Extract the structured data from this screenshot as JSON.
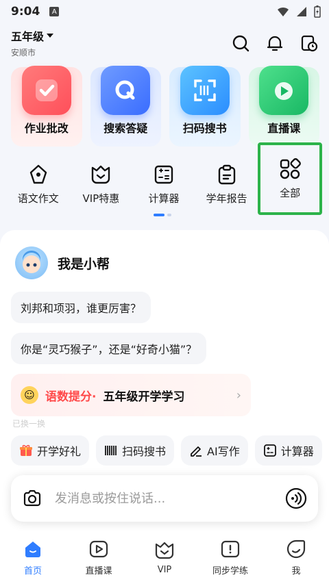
{
  "status_bar": {
    "time": "9:04",
    "notification_letter": "A"
  },
  "header": {
    "grade": "五年级",
    "city": "安顺市"
  },
  "quick_actions": [
    {
      "label": "作业批改",
      "icon": "checkmark-icon"
    },
    {
      "label": "搜索答疑",
      "icon": "search-q-icon"
    },
    {
      "label": "扫码搜书",
      "icon": "scan-icon"
    },
    {
      "label": "直播课",
      "icon": "play-icon"
    }
  ],
  "tools": [
    {
      "label": "语文作文",
      "icon": "pen-nib-icon"
    },
    {
      "label": "VIP特惠",
      "icon": "vip-crown-icon"
    },
    {
      "label": "计算器",
      "icon": "calculator-icon"
    },
    {
      "label": "学年报告",
      "icon": "clipboard-icon"
    },
    {
      "label": "全部",
      "icon": "grid-icon"
    }
  ],
  "chat": {
    "bot_name": "我是小帮",
    "suggestions": [
      "刘邦和项羽，谁更厉害？",
      "你是“灵巧猴子”，还是“好奇小猫”？"
    ],
    "promo": {
      "tag": "语数提分·",
      "text": "五年级开学学习"
    },
    "faded_text": "已换一换"
  },
  "chips": [
    {
      "label": "开学好礼",
      "icon": "gift-icon"
    },
    {
      "label": "扫码搜书",
      "icon": "barcode-icon"
    },
    {
      "label": "AI写作",
      "icon": "pencil-icon"
    },
    {
      "label": "计算器",
      "icon": "calculator-icon"
    }
  ],
  "input": {
    "placeholder": "发消息或按住说话..."
  },
  "tabbar": [
    {
      "label": "首页",
      "active": true
    },
    {
      "label": "直播课",
      "active": false
    },
    {
      "label": "VIP",
      "active": false
    },
    {
      "label": "同步学练",
      "active": false
    },
    {
      "label": "我",
      "active": false
    }
  ],
  "colors": {
    "accent": "#2f7dff",
    "highlight_border": "#2db34a",
    "promo_tag": "#ff4a4a"
  }
}
